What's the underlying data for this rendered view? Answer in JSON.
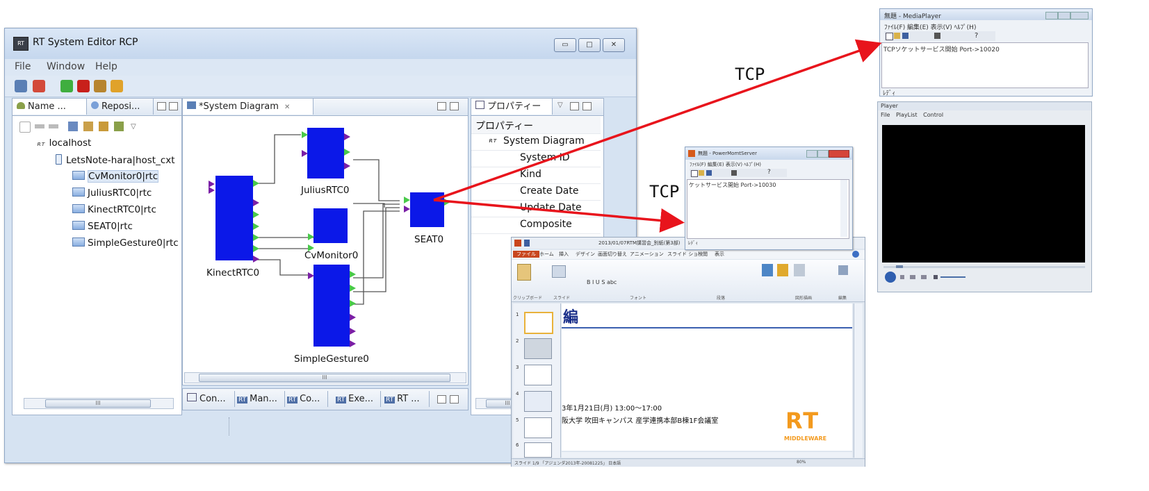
{
  "editor": {
    "title": "RT System Editor RCP",
    "window_controls": [
      "▭",
      "□",
      "✕"
    ],
    "menu": [
      "File",
      "Window",
      "Help"
    ],
    "name_pane": {
      "tabs": [
        "Name ...",
        "Reposi..."
      ],
      "tree": {
        "root": "localhost",
        "host": "LetsNote-hara|host_cxt",
        "components": [
          "CvMonitor0|rtc",
          "JuliusRTC0|rtc",
          "KinectRTC0|rtc",
          "SEAT0|rtc",
          "SimpleGesture0|rtc"
        ],
        "selected_index": 0
      },
      "scroll_text": "III"
    },
    "diagram_pane": {
      "tab": "*System Diagram",
      "blocks": [
        "JuliusRTC0",
        "KinectRTC0",
        "CvMonitor0",
        "SEAT0",
        "SimpleGesture0"
      ],
      "scroll_text": "III"
    },
    "bottom_tabs": [
      "Con...",
      "Man...",
      "Co...",
      "Exe...",
      "RT ..."
    ],
    "rt_badge": "RT",
    "properties_pane": {
      "tab": "プロパティー",
      "header": "プロパティー",
      "root": "System Diagram",
      "rows": [
        "System ID",
        "Kind",
        "Create Date",
        "Update Date",
        "Composite"
      ],
      "scroll_text": "III"
    }
  },
  "annotations": {
    "tcp_top": "TCP",
    "tcp_mid": "TCP",
    "arrow_color": "#e8141c"
  },
  "media_player": {
    "title": "無題 - MediaPlayer",
    "menu": "ﾌｧｲﾙ(F)  編集(E)  表示(V)  ﾍﾙﾌﾟ(H)",
    "log": "TCPソケットサービス開始  Port->10020",
    "status": "ﾚﾃﾞｨ"
  },
  "player": {
    "title": "Player",
    "menu": [
      "File",
      "PlayList",
      "Control"
    ]
  },
  "pmserver": {
    "title": "無題 - PowerMomtServer",
    "menu": "ﾌｧｲﾙ(F)  編集(E)  表示(V)  ﾍﾙﾌﾟ(H)",
    "log": "ケットサービス開始  Port->10030",
    "status": "ﾚﾃﾞｨ"
  },
  "powerpoint": {
    "filename": "2013/01/07RTM講習会_別紙(第3部)",
    "ribbon_tabs": [
      "ファイル",
      "ホーム",
      "挿入",
      "デザイン",
      "画面切り替え",
      "アニメーション",
      "スライド ショー",
      "校閲",
      "表示"
    ],
    "group_labels": [
      "クリップボード",
      "スライド",
      "フォント",
      "段落",
      "図形描画",
      "編集"
    ],
    "slide_title": "編",
    "slide_line1": "3年1月21日(月)  13:00～17:00",
    "slide_line2": "阪大学  吹田キャンパス  産学連携本部B棟1F会議室",
    "logo_text": "RT",
    "logo_sub": "MIDDLEWARE",
    "thumb_numbers": [
      "1",
      "2",
      "3",
      "4",
      "5",
      "6"
    ],
    "status_left": "スライド 1/9   「アジェンダ2013年-20081225」   日本語",
    "status_zoom": "80%"
  }
}
